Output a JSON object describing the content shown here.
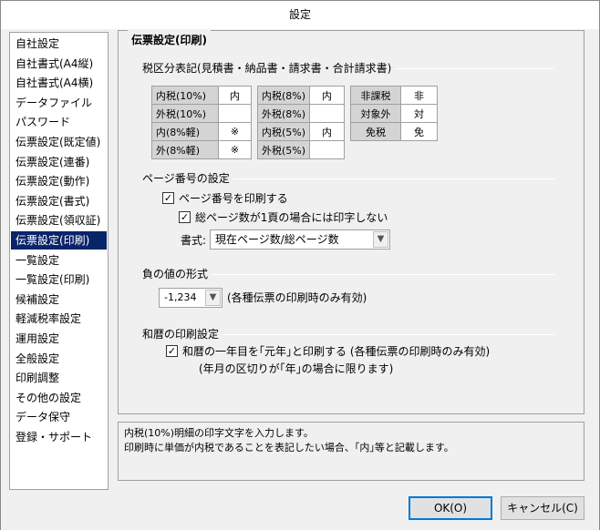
{
  "window": {
    "title": "設定"
  },
  "sidebar": {
    "items": [
      {
        "label": "自社設定"
      },
      {
        "label": "自社書式(A4縦)"
      },
      {
        "label": "自社書式(A4横)"
      },
      {
        "label": "データファイル"
      },
      {
        "label": "パスワード"
      },
      {
        "label": "伝票設定(既定値)"
      },
      {
        "label": "伝票設定(連番)"
      },
      {
        "label": "伝票設定(動作)"
      },
      {
        "label": "伝票設定(書式)"
      },
      {
        "label": "伝票設定(領収証)"
      },
      {
        "label": "伝票設定(印刷)",
        "selected": true
      },
      {
        "label": "一覧設定"
      },
      {
        "label": "一覧設定(印刷)"
      },
      {
        "label": "候補設定"
      },
      {
        "label": "軽減税率設定"
      },
      {
        "label": "運用設定"
      },
      {
        "label": "全般設定"
      },
      {
        "label": "印刷調整"
      },
      {
        "label": "その他の設定"
      },
      {
        "label": "データ保守"
      },
      {
        "label": "登録・サポート"
      }
    ]
  },
  "main": {
    "title": "伝票設定(印刷)",
    "tax_section": {
      "title": "税区分表記(見積書・納品書・請求書・合計請求書)",
      "table1": [
        {
          "label": "内税(10%)",
          "value": "内"
        },
        {
          "label": "外税(10%)",
          "value": ""
        },
        {
          "label": "内(8%軽)",
          "value": "※"
        },
        {
          "label": "外(8%軽)",
          "value": "※"
        }
      ],
      "table2": [
        {
          "label": "内税(8%)",
          "value": "内"
        },
        {
          "label": "外税(8%)",
          "value": ""
        },
        {
          "label": "内税(5%)",
          "value": "内"
        },
        {
          "label": "外税(5%)",
          "value": ""
        }
      ],
      "table3": [
        {
          "label": "非課税",
          "value": "非"
        },
        {
          "label": "対象外",
          "value": "対"
        },
        {
          "label": "免税",
          "value": "免"
        }
      ]
    },
    "page_section": {
      "title": "ページ番号の設定",
      "print_page_label": "ページ番号を印刷する",
      "no_print_single_label": "総ページ数が1頁の場合には印字しない",
      "format_label": "書式:",
      "format_value": "現在ページ数/総ページ数"
    },
    "negative_section": {
      "title": "負の値の形式",
      "value": "-1,234",
      "note": "(各種伝票の印刷時のみ有効)"
    },
    "wareki_section": {
      "title": "和暦の印刷設定",
      "label": "和暦の一年目を｢元年｣と印刷する (各種伝票の印刷時のみ有効)",
      "note": "(年月の区切りが｢年｣の場合に限ります)"
    }
  },
  "description": {
    "line1": "内税(10%)明細の印字文字を入力します。",
    "line2": "印刷時に単価が内税であることを表記したい場合、｢内｣等と記載します。"
  },
  "buttons": {
    "ok": "OK(O)",
    "cancel": "キャンセル(C)"
  }
}
